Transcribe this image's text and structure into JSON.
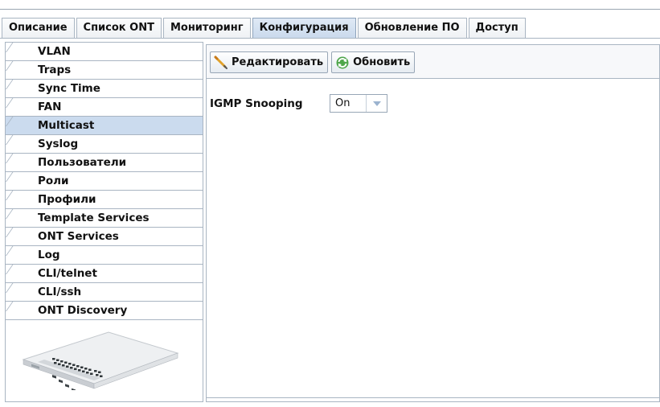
{
  "tabs": [
    {
      "label": "Описание",
      "active": false
    },
    {
      "label": "Список ONT",
      "active": false
    },
    {
      "label": "Мониторинг",
      "active": false
    },
    {
      "label": "Конфигурация",
      "active": true
    },
    {
      "label": "Обновление ПО",
      "active": false
    },
    {
      "label": "Доступ",
      "active": false
    }
  ],
  "sidebar": {
    "items": [
      {
        "label": "VLAN",
        "active": false
      },
      {
        "label": "Traps",
        "active": false
      },
      {
        "label": "Sync Time",
        "active": false
      },
      {
        "label": "FAN",
        "active": false
      },
      {
        "label": "Multicast",
        "active": true
      },
      {
        "label": "Syslog",
        "active": false
      },
      {
        "label": "Пользователи",
        "active": false
      },
      {
        "label": "Роли",
        "active": false
      },
      {
        "label": "Профили",
        "active": false
      },
      {
        "label": "Template Services",
        "active": false
      },
      {
        "label": "ONT Services",
        "active": false
      },
      {
        "label": "Log",
        "active": false
      },
      {
        "label": "CLI/telnet",
        "active": false
      },
      {
        "label": "CLI/ssh",
        "active": false
      },
      {
        "label": "ONT Discovery",
        "active": false
      }
    ],
    "device_icon": "olt-switch-device-image"
  },
  "toolbar": {
    "edit_label": "Редактировать",
    "edit_icon": "pencil-icon",
    "refresh_label": "Обновить",
    "refresh_icon": "refresh-icon"
  },
  "form": {
    "igmp_label": "IGMP Snooping",
    "igmp_value": "On"
  },
  "colors": {
    "active_tab": "#c9d9ec",
    "active_item": "#cbdbee",
    "border": "#a9b5c2"
  }
}
